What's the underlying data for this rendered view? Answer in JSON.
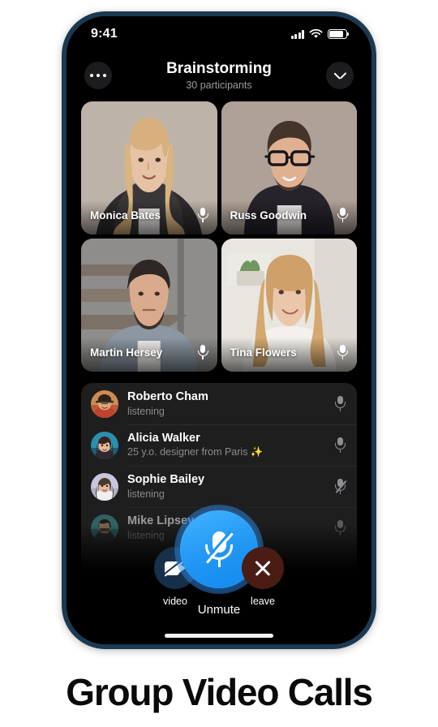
{
  "status_bar": {
    "time": "9:41",
    "signal_icon": "cellular-bars-icon",
    "wifi_icon": "wifi-icon",
    "battery_icon": "battery-icon"
  },
  "header": {
    "more_icon": "more-dots-icon",
    "title": "Brainstorming",
    "subtitle": "30 participants",
    "collapse_icon": "chevron-down-icon"
  },
  "video_grid": [
    {
      "name": "Monica Bates",
      "mic_icon": "microphone-icon",
      "muted": false
    },
    {
      "name": "Russ Goodwin",
      "mic_icon": "microphone-icon",
      "muted": false
    },
    {
      "name": "Martin Hersey",
      "mic_icon": "microphone-icon",
      "muted": false
    },
    {
      "name": "Tina Flowers",
      "mic_icon": "microphone-icon",
      "muted": false
    }
  ],
  "participants": [
    {
      "name": "Roberto Cham",
      "status": "listening",
      "mic_icon": "microphone-icon",
      "muted": false
    },
    {
      "name": "Alicia Walker",
      "status": "25 y.o. designer from Paris ✨",
      "mic_icon": "microphone-icon",
      "muted": false
    },
    {
      "name": "Sophie Bailey",
      "status": "listening",
      "mic_icon": "microphone-muted-icon",
      "muted": true
    },
    {
      "name": "Mike Lipsey",
      "status": "listening",
      "mic_icon": "microphone-icon",
      "muted": false
    }
  ],
  "controls": {
    "video_label": "video",
    "video_icon": "camera-off-icon",
    "main_label": "Unmute",
    "main_icon": "microphone-muted-icon",
    "leave_label": "leave",
    "leave_icon": "close-x-icon"
  },
  "caption": "Group Video Calls",
  "colors": {
    "accent_blue": "#2196f3",
    "bezel": "#1b3a52",
    "panel": "#1e1e1e",
    "video_button": "#16304a",
    "leave_button": "#4a1c14",
    "screen": "#000000"
  }
}
